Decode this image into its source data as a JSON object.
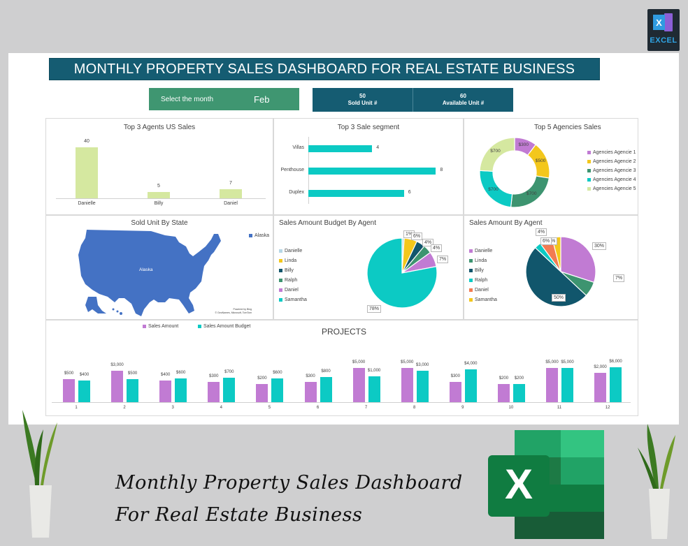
{
  "badge": {
    "label": "EXCEL",
    "icon": "excel-icon"
  },
  "header": {
    "title": "MONTHLY PROPERTY SALES DASHBOARD FOR REAL ESTATE BUSINESS"
  },
  "month_selector": {
    "label": "Select the month",
    "value": "Feb"
  },
  "kpis": [
    {
      "value": "50",
      "label": "Sold Unit #"
    },
    {
      "value": "60",
      "label": "Available Unit #"
    }
  ],
  "footer": {
    "line1": "Monthly Property Sales Dashboard",
    "line2": "For Real Estate Business",
    "logo": "excel-logo-icon"
  },
  "colors": {
    "header": "#155c72",
    "month": "#3f9671",
    "lime": "#d5e8a0",
    "teal": "#0ccac4",
    "purple": "#c17bd3",
    "gold": "#f3c71c",
    "navy": "#11566c",
    "green": "#3d9470",
    "orange": "#f27b52",
    "lightblue": "#b6d7e6",
    "map": "#4472c4"
  },
  "chart_data": [
    {
      "id": "top-agents",
      "type": "bar",
      "title": "Top 3 Agents US Sales",
      "categories": [
        "Danielle",
        "Billy",
        "Daniel"
      ],
      "values": [
        40,
        5,
        7
      ],
      "ylim": [
        0,
        45
      ]
    },
    {
      "id": "sale-segment",
      "type": "bar",
      "orientation": "horizontal",
      "title": "Top 3 Sale segment",
      "categories": [
        "Villas",
        "Penthouse",
        "Duplex"
      ],
      "values": [
        4,
        8,
        6
      ],
      "xlim": [
        0,
        9
      ]
    },
    {
      "id": "agencies",
      "type": "pie",
      "variant": "donut",
      "title": "Top 5 Agencies Sales",
      "categories": [
        "Agencies Agencie 1",
        "Agencies Agencie 2",
        "Agencies Agencie 3",
        "Agencies Agencie 4",
        "Agencies Agencie 5"
      ],
      "values": [
        300,
        500,
        700,
        700,
        700
      ],
      "labels": [
        "$300",
        "$500",
        "$700",
        "$700",
        "$700"
      ],
      "legend": "right"
    },
    {
      "id": "map",
      "type": "map",
      "title": "Sold Unit By State",
      "legend": [
        "Alaska"
      ],
      "region_label": "Alaska",
      "attribution": [
        "Powered by Bing",
        "© GeoNames, Microsoft, TomTom"
      ]
    },
    {
      "id": "budget-by-agent",
      "type": "pie",
      "title": "Sales Amount Budget By Agent",
      "categories": [
        "Danielle",
        "Linda",
        "Billy",
        "Ralph",
        "Daniel",
        "Samantha"
      ],
      "values": [
        1,
        6,
        4,
        4,
        7,
        78
      ],
      "labels": [
        "1%",
        "6%",
        "4%",
        "4%",
        "7%",
        "78%"
      ],
      "legend": "left"
    },
    {
      "id": "sales-by-agent",
      "type": "pie",
      "title": "Sales Amount By Agent",
      "categories": [
        "Danielle",
        "Linda",
        "Billy",
        "Ralph",
        "Daniel",
        "Samantha"
      ],
      "values": [
        30,
        7,
        50,
        3,
        6,
        4
      ],
      "labels": [
        "30%",
        "7%",
        "50%",
        "%",
        "6%",
        "4%"
      ],
      "legend": "left"
    },
    {
      "id": "projects",
      "type": "bar",
      "title": "PROJECTS",
      "scale": "log",
      "categories": [
        "1",
        "2",
        "3",
        "4",
        "5",
        "6",
        "7",
        "8",
        "9",
        "10",
        "11",
        "12"
      ],
      "series": [
        {
          "name": "Sales Amount",
          "values": [
            500,
            3000,
            400,
            300,
            200,
            300,
            5000,
            5000,
            300,
            200,
            5000,
            2000
          ],
          "labels": [
            "$500",
            "$3,000",
            "$400",
            "$300",
            "$200",
            "$300",
            "$5,000",
            "$5,000",
            "$300",
            "$200",
            "$5,000",
            "$2,000"
          ]
        },
        {
          "name": "Sales Amount Budget",
          "values": [
            400,
            500,
            600,
            700,
            600,
            800,
            1000,
            3000,
            4000,
            200,
            5000,
            6000
          ],
          "labels": [
            "$400",
            "$500",
            "$600",
            "$700",
            "$600",
            "$800",
            "$1,000",
            "$3,000",
            "$4,000",
            "$200",
            "$5,000",
            "$6,000"
          ]
        }
      ],
      "legend": "top-left"
    }
  ]
}
